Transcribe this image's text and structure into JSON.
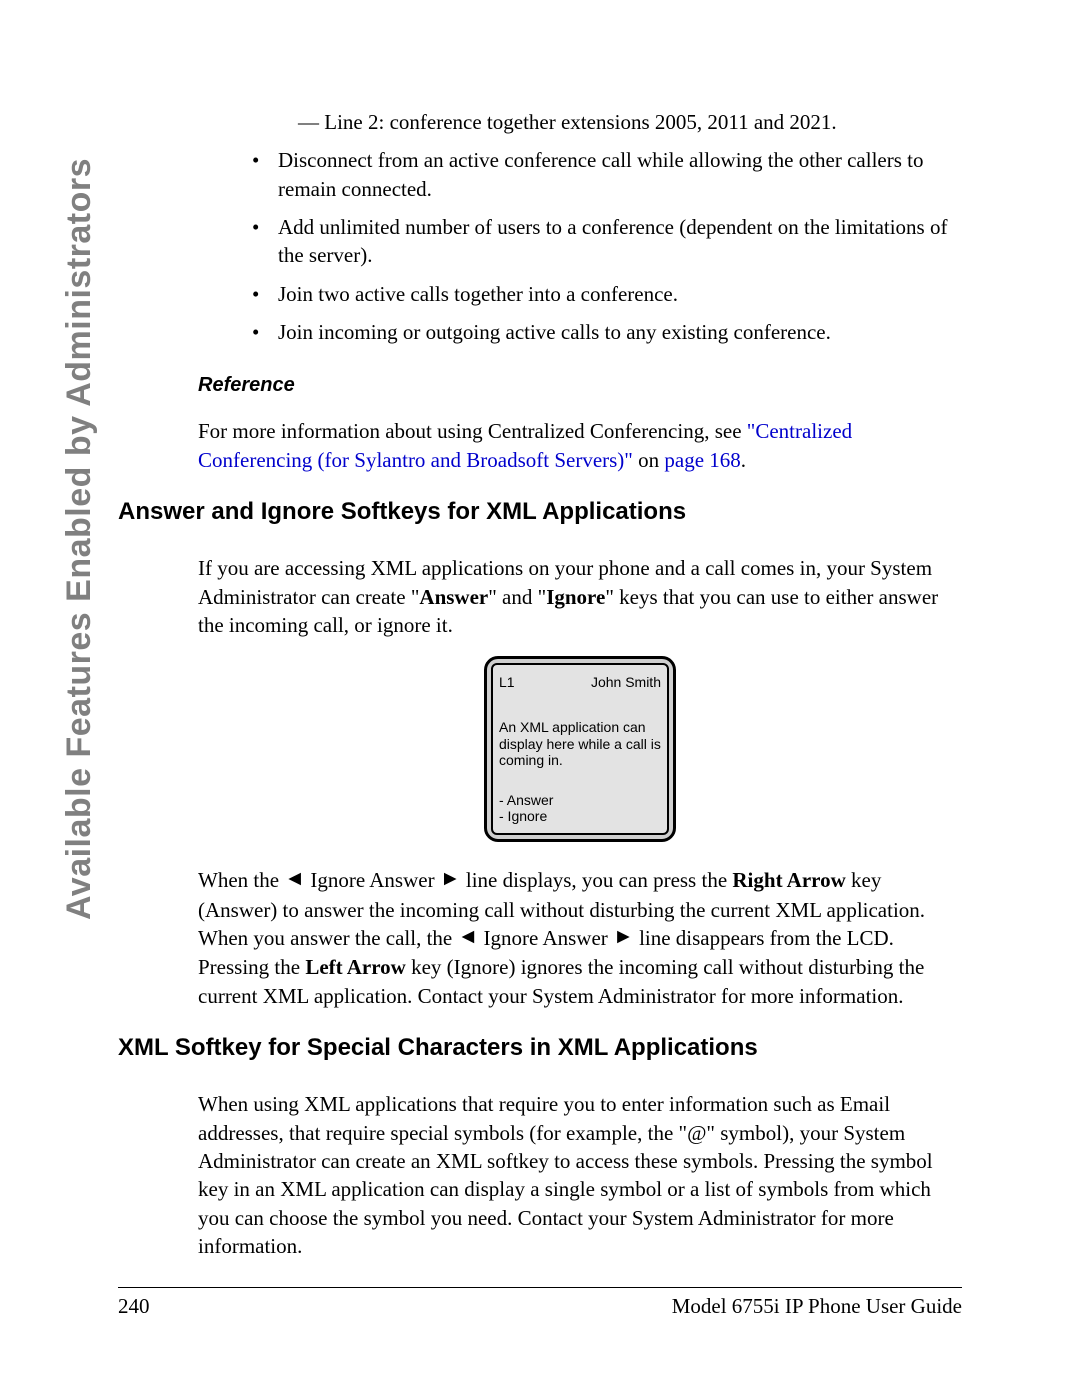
{
  "sidebar": {
    "label": "Available Features Enabled by Administrators"
  },
  "dash_items": [
    "Line 2: conference together extensions 2005, 2011 and 2021."
  ],
  "bullets": [
    "Disconnect from an active conference call while allowing the other callers to remain connected.",
    "Add unlimited number of users to a conference (dependent on the limitations of the server).",
    "Join two active calls together into a conference.",
    "Join incoming or outgoing active calls to any existing conference."
  ],
  "reference": {
    "heading": "Reference",
    "prefix": "For more information about using Centralized Conferencing, see ",
    "link": "\"Centralized Conferencing (for Sylantro and Broadsoft Servers)\"",
    "mid": " on ",
    "page_link": "page 168",
    "suffix": "."
  },
  "section1": {
    "title": "Answer and Ignore Softkeys for XML Applications",
    "para1_a": "If you are accessing XML applications on your phone and a call comes in, your System Administrator can create \"",
    "para1_b": "Answer",
    "para1_c": "\" and \"",
    "para1_d": "Ignore",
    "para1_e": "\" keys that you can use to either answer the incoming call, or ignore it.",
    "para2_a": "When the ",
    "arrow_left": "◄",
    "para2_b": " Ignore Answer ",
    "arrow_right": "►",
    "para2_c": " line displays, you can press the ",
    "para2_d": "Right Arrow",
    "para2_e": " key (Answer) to answer the incoming call without disturbing the current XML application. When you answer the call, the ",
    "para2_f": " line disappears from the LCD. Pressing the ",
    "para2_g": "Left Arrow",
    "para2_h": " key (Ignore) ignores the incoming call without disturbing the current XML application. Contact your System Administrator for more information."
  },
  "phone": {
    "line": "L1",
    "caller": "John Smith",
    "msg": "An XML application can display here while a call is coming in.",
    "opt1": "- Answer",
    "opt2": "- Ignore"
  },
  "section2": {
    "title": "XML Softkey for Special Characters in XML Applications",
    "para": "When using XML applications that require you to enter information such as Email addresses, that require special symbols (for example, the \"@\" symbol), your System Administrator can create an XML softkey to access these symbols. Pressing the symbol key in an XML application can display a single symbol or a list of symbols from which you can choose the symbol you need. Contact your System Administrator for more information."
  },
  "footer": {
    "page_num": "240",
    "doc_title": "Model 6755i IP Phone User Guide"
  }
}
